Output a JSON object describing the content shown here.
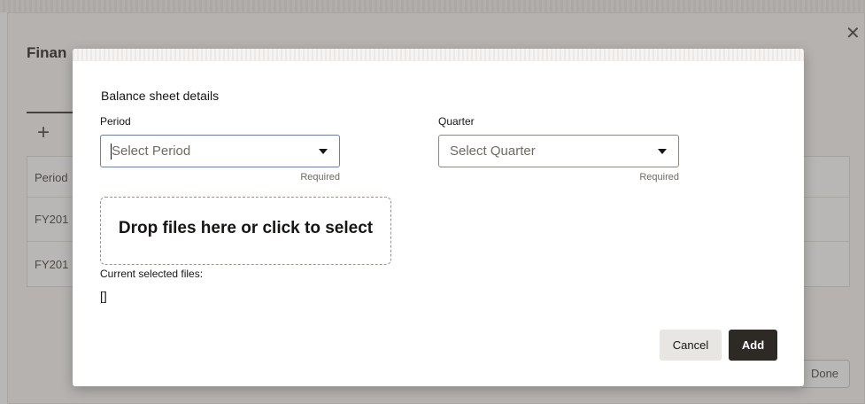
{
  "background": {
    "title": "Finan",
    "close_icon": "close-icon",
    "add_icon": "plus-icon",
    "table": {
      "header": "Period",
      "rows": [
        "FY201",
        "FY201"
      ]
    },
    "done_label": "Done"
  },
  "dialog": {
    "heading": "Balance sheet details",
    "period": {
      "label": "Period",
      "placeholder": "Select Period",
      "helper": "Required"
    },
    "quarter": {
      "label": "Quarter",
      "placeholder": "Select Quarter",
      "helper": "Required"
    },
    "dropzone_text": "Drop files here or click to select",
    "files_label": "Current selected files:",
    "files_value": "[]",
    "cancel_label": "Cancel",
    "add_label": "Add"
  }
}
